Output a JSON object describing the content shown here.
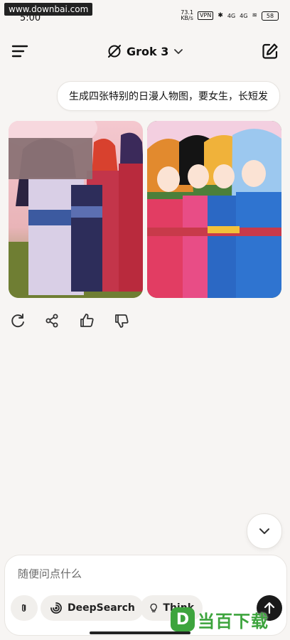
{
  "status_bar": {
    "watermark": "www.downbai.com",
    "time": "5:00",
    "net_speed_value": "73.1",
    "net_speed_unit": "KB/s",
    "vpn": "VPN",
    "signal_1": "4G",
    "signal_2": "4G",
    "battery": "58"
  },
  "header": {
    "model_name": "Grok 3",
    "icons": [
      "menu-icon",
      "grok-logo-icon",
      "chevron-down-icon",
      "edit-icon"
    ]
  },
  "chat": {
    "user_message": "生成四张特别的日漫人物图，要女生，长短发",
    "images": [
      {
        "name": "anime-girls-kimono-image-1",
        "palette": [
          "#f2c0c8",
          "#6a4b8a",
          "#c9344a"
        ]
      },
      {
        "name": "anime-girls-kimono-image-2",
        "palette": [
          "#e0406a",
          "#2c6ed0",
          "#f2b23a"
        ]
      }
    ],
    "actions": [
      "regenerate-icon",
      "share-icon",
      "thumbs-up-icon",
      "thumbs-down-icon"
    ]
  },
  "composer": {
    "placeholder": "随便问点什么",
    "deepsearch_label": "DeepSearch",
    "think_label": "Think"
  },
  "logo": {
    "mark": "D",
    "text": "当百下载"
  }
}
